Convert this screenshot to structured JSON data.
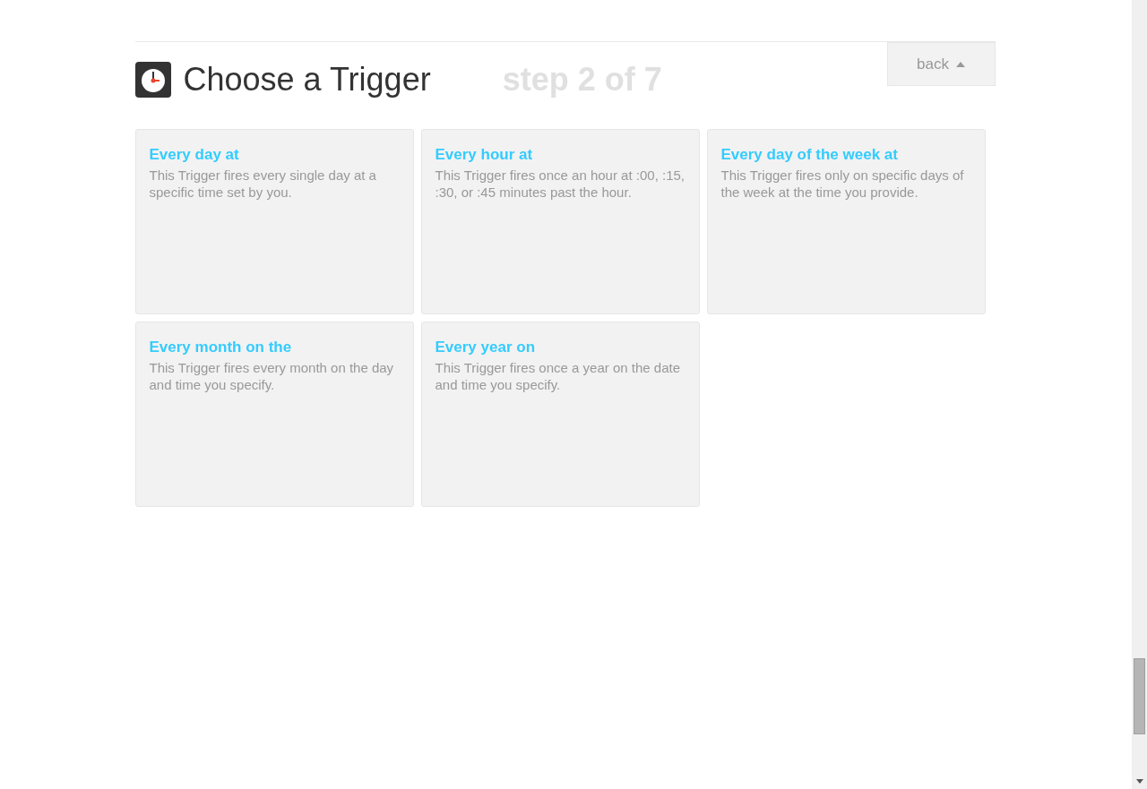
{
  "header": {
    "title": "Choose a Trigger",
    "step": "step 2 of 7",
    "back_button": "back"
  },
  "triggers": [
    {
      "title": "Every day at",
      "description": "This Trigger fires every single day at a specific time set by you."
    },
    {
      "title": "Every hour at",
      "description": "This Trigger fires once an hour at :00, :15, :30, or :45 minutes past the hour."
    },
    {
      "title": "Every day of the week at",
      "description": "This Trigger fires only on specific days of the week at the time you provide."
    },
    {
      "title": "Every month on the",
      "description": "This Trigger fires every month on the day and time you specify."
    },
    {
      "title": "Every year on",
      "description": "This Trigger fires once a year on the date and time you specify."
    }
  ]
}
